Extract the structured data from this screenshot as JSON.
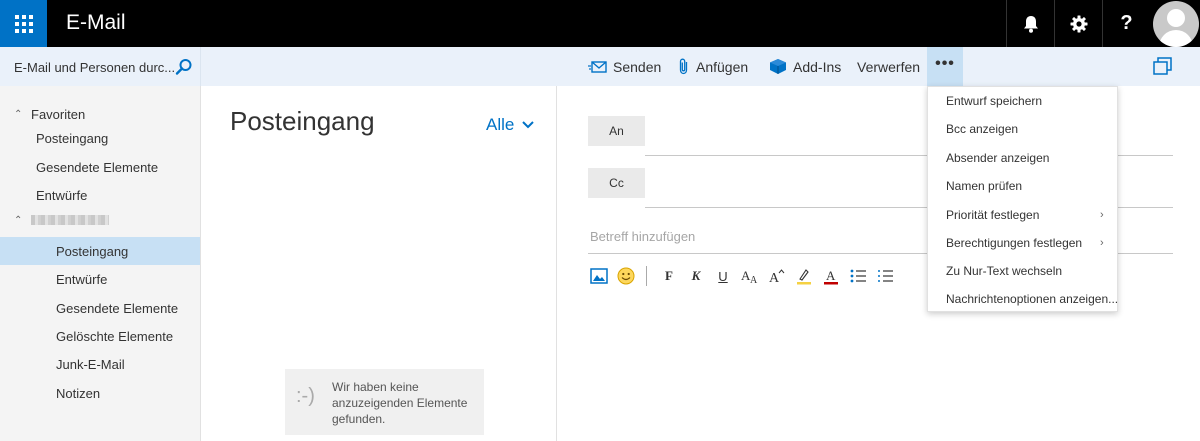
{
  "app": {
    "title": "E-Mail"
  },
  "search": {
    "placeholder": "E-Mail und Personen durc..."
  },
  "toolbar": {
    "send": "Senden",
    "attach": "Anfügen",
    "addins": "Add-Ins",
    "discard": "Verwerfen",
    "more": "•••"
  },
  "nav": {
    "favorites_label": "Favoriten",
    "favorites": [
      "Posteingang",
      "Gesendete Elemente",
      "Entwürfe"
    ],
    "account_label": "[blurred account name]",
    "folders": [
      "Posteingang",
      "Entwürfe",
      "Gesendete Elemente",
      "Gelöschte Elemente",
      "Junk-E-Mail",
      "Notizen"
    ],
    "selected_folder": "Posteingang"
  },
  "message_list": {
    "title": "Posteingang",
    "filter": "Alle",
    "empty_face": ":-)",
    "empty_text": "Wir haben keine anzuzeigenden Elemente gefunden."
  },
  "compose": {
    "to_label": "An",
    "cc_label": "Cc",
    "subject_placeholder": "Betreff hinzufügen",
    "format_letters": {
      "bold": "F",
      "italic": "K",
      "underline": "U"
    }
  },
  "more_menu": {
    "items": [
      {
        "label": "Entwurf speichern",
        "submenu": false
      },
      {
        "label": "Bcc anzeigen",
        "submenu": false
      },
      {
        "label": "Absender anzeigen",
        "submenu": false
      },
      {
        "label": "Namen prüfen",
        "submenu": false
      },
      {
        "label": "Priorität festlegen",
        "submenu": true
      },
      {
        "label": "Berechtigungen festlegen",
        "submenu": true
      },
      {
        "label": "Zu Nur-Text wechseln",
        "submenu": false
      },
      {
        "label": "Nachrichtenoptionen anzeigen...",
        "submenu": false
      }
    ]
  },
  "colors": {
    "accent": "#0072c6",
    "topbar": "#000000",
    "commandbar": "#eaf1fa",
    "selected": "#c7e0f4",
    "nav_bg": "#f4f4f4"
  },
  "icons": {
    "launcher": "app-launcher-icon",
    "bell": "bell-icon",
    "settings": "gear-icon",
    "help": "help-icon",
    "search": "search-icon",
    "send": "send-icon",
    "attach": "paperclip-icon",
    "addins": "addins-icon",
    "popout": "popout-icon"
  }
}
